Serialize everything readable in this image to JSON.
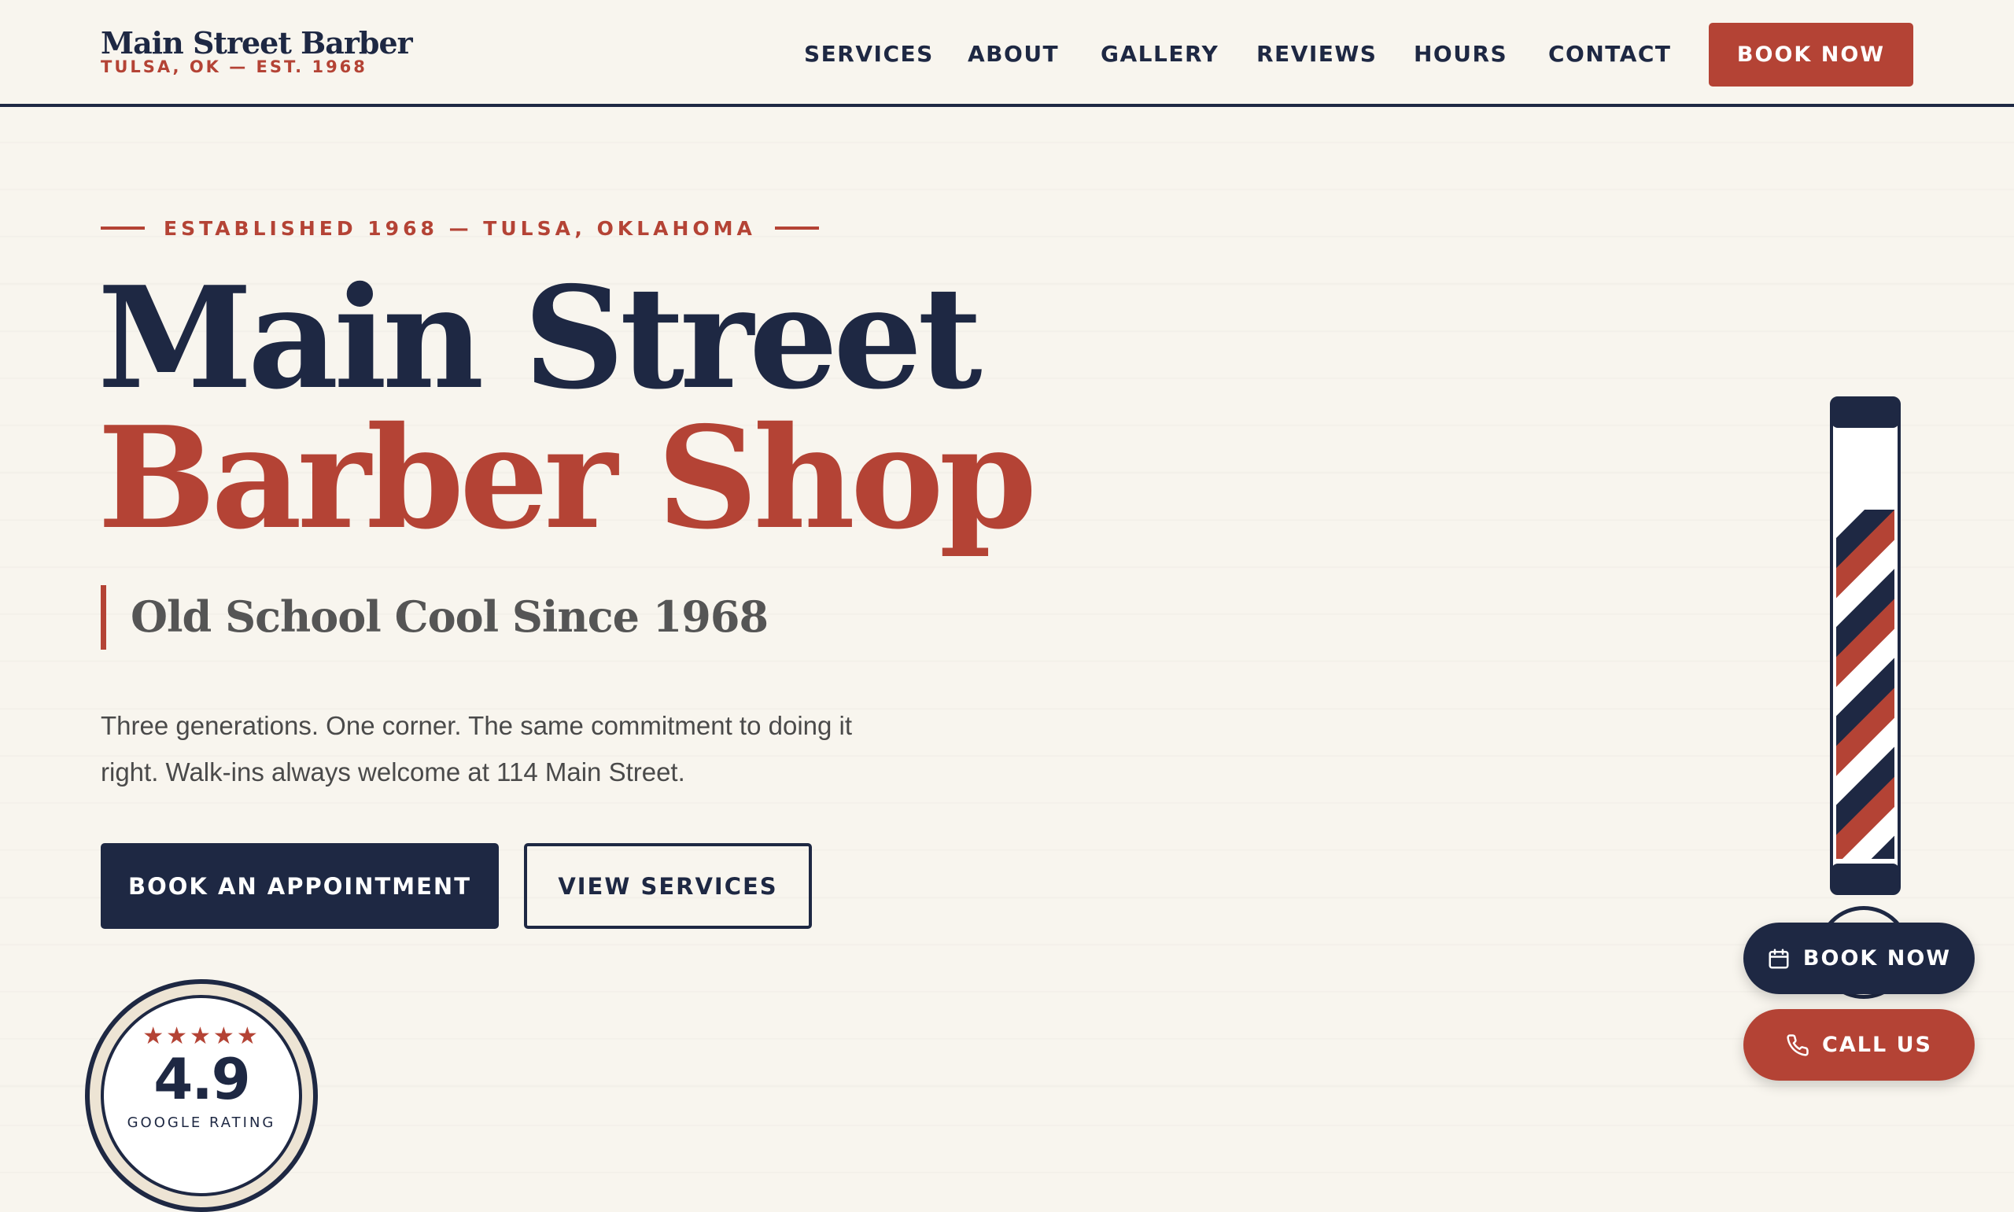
{
  "header": {
    "brand_name": "Main Street Barber",
    "brand_sub": "TULSA, OK — EST. 1968",
    "nav": [
      "SERVICES",
      "ABOUT",
      "GALLERY",
      "REVIEWS",
      "HOURS",
      "CONTACT"
    ],
    "book_label": "BOOK NOW"
  },
  "hero": {
    "eyebrow": "ESTABLISHED 1968 — TULSA, OKLAHOMA",
    "title_line1": "Main Street",
    "title_line2": "Barber Shop",
    "tagline": "Old School Cool Since 1968",
    "description_line1": "Three generations. One corner. The same commitment to doing it",
    "description_line2": "right. Walk-ins always welcome at 114 Main Street.",
    "primary_button": "BOOK AN APPOINTMENT",
    "secondary_button": "VIEW SERVICES"
  },
  "rating_badge": {
    "stars": "★★★★★",
    "score": "4.9",
    "label": "GOOGLE RATING"
  },
  "floating_actions": {
    "book_label": "BOOK NOW",
    "call_label": "CALL US"
  },
  "colors": {
    "navy": "#1e2843",
    "brick_red": "#b44335",
    "cream": "#f8f5ee"
  },
  "icons": {
    "barber_pole": "barber-pole-icon",
    "calendar": "calendar-icon",
    "phone": "phone-icon"
  }
}
